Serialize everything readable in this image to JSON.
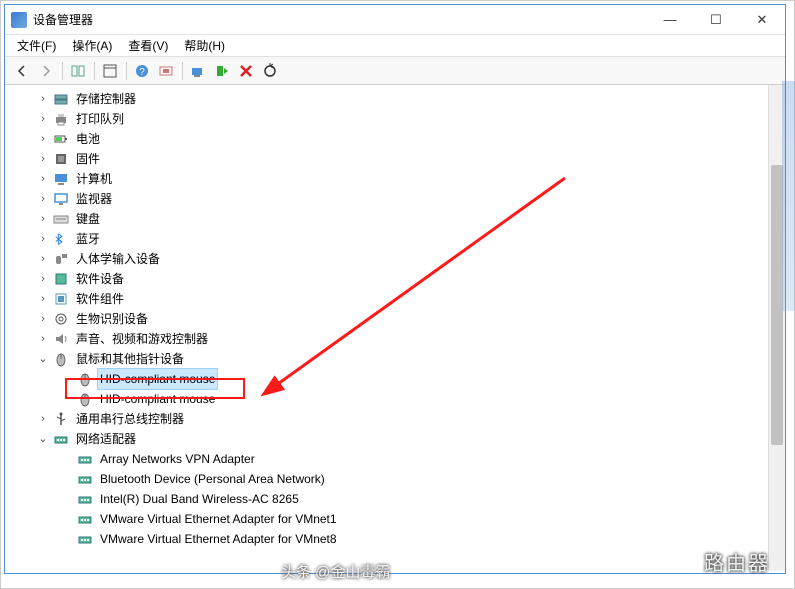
{
  "window": {
    "title": "设备管理器"
  },
  "menu": {
    "file": "文件(F)",
    "action": "操作(A)",
    "view": "查看(V)",
    "help": "帮助(H)"
  },
  "toolbar_icons": {
    "back": "back-arrow",
    "forward": "forward-arrow",
    "up": "show-hidden",
    "props": "properties",
    "help": "help",
    "scan": "scan-hardware",
    "view": "view",
    "add": "add-legacy",
    "remove": "uninstall",
    "refresh": "refresh"
  },
  "tree": [
    {
      "d": 1,
      "tw": ">",
      "ic": "storage",
      "label": "存储控制器"
    },
    {
      "d": 1,
      "tw": ">",
      "ic": "printer",
      "label": "打印队列"
    },
    {
      "d": 1,
      "tw": ">",
      "ic": "battery",
      "label": "电池"
    },
    {
      "d": 1,
      "tw": ">",
      "ic": "firmware",
      "label": "固件"
    },
    {
      "d": 1,
      "tw": ">",
      "ic": "computer",
      "label": "计算机"
    },
    {
      "d": 1,
      "tw": ">",
      "ic": "monitor",
      "label": "监视器"
    },
    {
      "d": 1,
      "tw": ">",
      "ic": "keyboard",
      "label": "键盘"
    },
    {
      "d": 1,
      "tw": ">",
      "ic": "bluetooth",
      "label": "蓝牙"
    },
    {
      "d": 1,
      "tw": ">",
      "ic": "hid",
      "label": "人体学输入设备"
    },
    {
      "d": 1,
      "tw": ">",
      "ic": "software",
      "label": "软件设备"
    },
    {
      "d": 1,
      "tw": ">",
      "ic": "component",
      "label": "软件组件"
    },
    {
      "d": 1,
      "tw": ">",
      "ic": "biometric",
      "label": "生物识别设备"
    },
    {
      "d": 1,
      "tw": ">",
      "ic": "audio",
      "label": "声音、视频和游戏控制器"
    },
    {
      "d": 1,
      "tw": "v",
      "ic": "mouse",
      "label": "鼠标和其他指针设备"
    },
    {
      "d": 2,
      "tw": "",
      "ic": "mouse",
      "label": "HID-compliant mouse",
      "sel": true
    },
    {
      "d": 2,
      "tw": "",
      "ic": "mouse",
      "label": "HID-compliant mouse"
    },
    {
      "d": 1,
      "tw": ">",
      "ic": "usb",
      "label": "通用串行总线控制器"
    },
    {
      "d": 1,
      "tw": "v",
      "ic": "network",
      "label": "网络适配器"
    },
    {
      "d": 2,
      "tw": "",
      "ic": "network",
      "label": "Array Networks VPN Adapter"
    },
    {
      "d": 2,
      "tw": "",
      "ic": "network",
      "label": "Bluetooth Device (Personal Area Network)"
    },
    {
      "d": 2,
      "tw": "",
      "ic": "network",
      "label": "Intel(R) Dual Band Wireless-AC 8265"
    },
    {
      "d": 2,
      "tw": "",
      "ic": "network",
      "label": "VMware Virtual Ethernet Adapter for VMnet1"
    },
    {
      "d": 2,
      "tw": "",
      "ic": "network",
      "label": "VMware Virtual Ethernet Adapter for VMnet8"
    }
  ],
  "watermarks": {
    "bottom_right": "路由器",
    "attribution": "头条 @金山毒霸"
  }
}
